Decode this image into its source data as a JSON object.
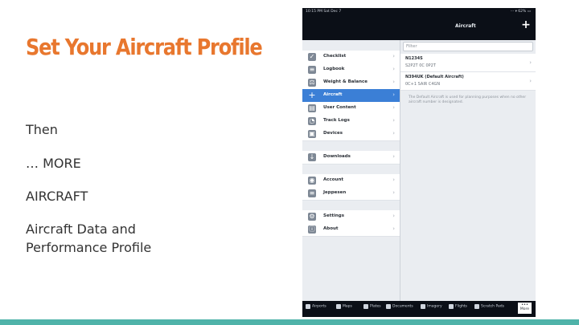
{
  "slide": {
    "title": "Set Your Aircraft Profile",
    "bullets": [
      "Then",
      "… MORE",
      "AIRCRAFT",
      "Aircraft Data and Performance Profile"
    ]
  },
  "device": {
    "status_time": "10:15 PM  Sat Dec 7",
    "status_right": "⋯ ▾ 62% ▭",
    "nav_title": "Aircraft",
    "add_button": "+",
    "menu": [
      {
        "label": "Checklist",
        "icon": "checklist-icon",
        "glyph": "✓"
      },
      {
        "label": "Logbook",
        "icon": "logbook-icon",
        "glyph": "≡"
      },
      {
        "label": "Weight & Balance",
        "icon": "scale-icon",
        "glyph": "⚖"
      },
      {
        "label": "Aircraft",
        "icon": "airplane-icon",
        "glyph": "✈",
        "selected": true
      },
      {
        "label": "User Content",
        "icon": "folder-icon",
        "glyph": "▤"
      },
      {
        "label": "Track Logs",
        "icon": "track-icon",
        "glyph": "◔"
      },
      {
        "label": "Devices",
        "icon": "device-icon",
        "glyph": "▣"
      },
      {
        "label": "Downloads",
        "icon": "download-icon",
        "glyph": "↓"
      },
      {
        "label": "Account",
        "icon": "account-icon",
        "glyph": "◉"
      },
      {
        "label": "Jeppesen",
        "icon": "jeppesen-icon",
        "glyph": "≡"
      },
      {
        "label": "Settings",
        "icon": "settings-icon",
        "glyph": "⚙"
      },
      {
        "label": "About",
        "icon": "info-icon",
        "glyph": "ⓘ"
      }
    ],
    "filter_placeholder": "Filter",
    "aircraft": [
      {
        "name": "N1234S",
        "sub": "S2P2T 0C 0P2T"
      },
      {
        "name": "N394UK (Default Aircraft)",
        "sub": "0C+1 SAIR C4GN"
      }
    ],
    "note": "The Default Aircraft is used for planning purposes when no other aircraft number is designated.",
    "tabs": [
      {
        "label": "Airports",
        "icon": "airport-icon"
      },
      {
        "label": "Maps",
        "icon": "maps-icon"
      },
      {
        "label": "Plates",
        "icon": "plates-icon"
      },
      {
        "label": "Documents",
        "icon": "documents-icon"
      },
      {
        "label": "Imagery",
        "icon": "imagery-icon"
      },
      {
        "label": "Flights",
        "icon": "flights-icon"
      },
      {
        "label": "Scratch Pads",
        "icon": "scratchpad-icon"
      },
      {
        "label": "More",
        "icon": "more-icon",
        "glyph": "•••",
        "active": true
      }
    ]
  }
}
